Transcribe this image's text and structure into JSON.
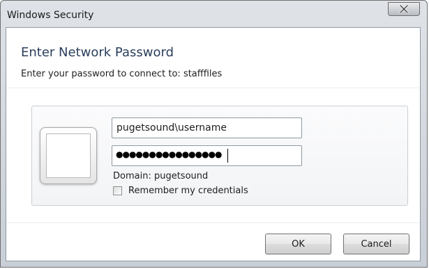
{
  "window": {
    "title": "Windows Security",
    "close_icon": "close-icon"
  },
  "dialog": {
    "heading": "Enter Network Password",
    "subheading": "Enter your password to connect to: stafffiles"
  },
  "credentials": {
    "user_tile_icon": "user-tile",
    "username_value": "pugetsound\\username",
    "password_masked": "●●●●●●●●●●●●●●●●",
    "domain_text": "Domain: pugetsound",
    "remember_label": "Remember my credentials",
    "remember_checked": false
  },
  "buttons": {
    "ok_label": "OK",
    "cancel_label": "Cancel"
  }
}
